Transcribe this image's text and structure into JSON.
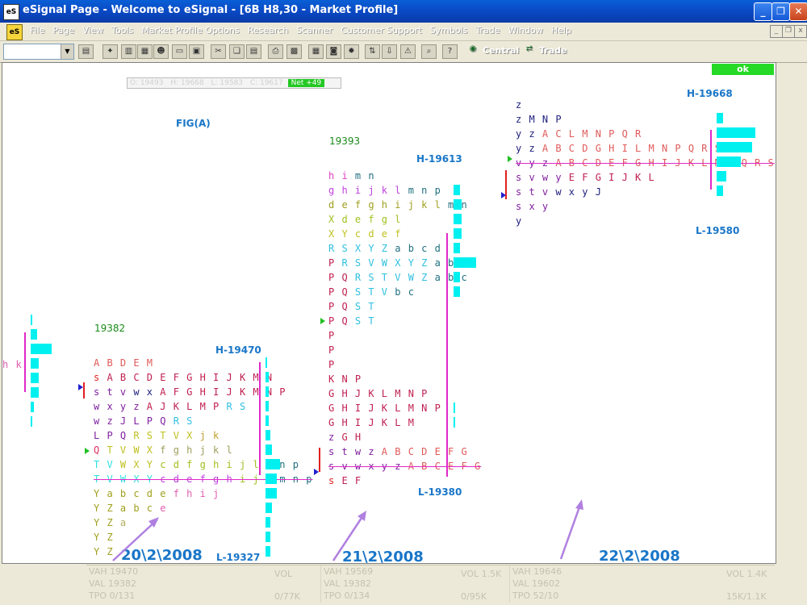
{
  "window": {
    "icon": "eS",
    "title": "eSignal Page - Welcome to eSignal - [6B H8,30 - Market Profile]",
    "controls": [
      "minimize-icon",
      "restore-icon",
      "close-icon"
    ]
  },
  "menu": {
    "items": [
      "File",
      "Page",
      "View",
      "Tools",
      "Market Profile Options",
      "Research",
      "Scanner",
      "Customer Support",
      "Symbols",
      "Trade",
      "Window",
      "Help"
    ]
  },
  "toolbar": {
    "symbol_value": "",
    "central_label": "Central",
    "trade_label": "Trade"
  },
  "status": {
    "ok": "ok"
  },
  "quote": {
    "o": "O: 19493",
    "h": "H: 19668",
    "l": "L: 19583",
    "c": "C: 19617",
    "net": "Net +49"
  },
  "chart": {
    "fig_label": "FIG(A)",
    "day1": {
      "open": "19382",
      "high": "H-19470",
      "low": "L-19327",
      "date": "20\\2\\2008"
    },
    "day2": {
      "open": "19393",
      "high": "H-19613",
      "low": "L-19380",
      "date": "21\\2\\2008"
    },
    "day3": {
      "high": "H-19668",
      "low": "L-19580",
      "date": "22\\2\\2008"
    },
    "left_fragment": "h k"
  },
  "profiles": {
    "day1": [
      [
        [
          "A B D E M",
          "#e05a5a"
        ]
      ],
      [
        [
          "s ",
          "#e02020"
        ],
        [
          "A B C D E F G H I J K M N",
          "#c02050"
        ]
      ],
      [
        [
          "s t v ",
          "#8020a0"
        ],
        [
          "w x ",
          "#202080"
        ],
        [
          "A F G H I J K M N P",
          "#c02050"
        ]
      ],
      [
        [
          "w x y z ",
          "#8020a0"
        ],
        [
          "A J K L M P ",
          "#c02050"
        ],
        [
          "R S",
          "#30c0e0"
        ]
      ],
      [
        [
          "w z J L P Q ",
          "#8020a0"
        ],
        [
          "R S",
          "#30c0e0"
        ]
      ],
      [
        [
          "L P Q ",
          "#8020a0"
        ],
        [
          "R S T V X ",
          "#c0c020"
        ],
        [
          "j k",
          "#c0a030"
        ]
      ],
      [
        [
          "Q ",
          "#e03060"
        ],
        [
          "T V W X ",
          "#c0c020"
        ],
        [
          "f g h j k l",
          "#a0a060"
        ]
      ],
      [
        [
          "T V ",
          "#30e0e0"
        ],
        [
          "W X Y ",
          "#c0c020"
        ],
        [
          "c d f g h i j l ",
          "#a0c020"
        ],
        [
          "m n p",
          "#207080"
        ]
      ],
      [
        [
          "T V W X Y ",
          "#30e0e0"
        ],
        [
          "c d e f g h ",
          "#c040e0"
        ],
        [
          "i j l ",
          "#a0c020"
        ],
        [
          "m n p",
          "#207080"
        ]
      ],
      [
        [
          "Y ",
          "#a0a020"
        ],
        [
          "a b c d e ",
          "#a0a020"
        ],
        [
          "f h i j",
          "#e060b0"
        ]
      ],
      [
        [
          "Y Z ",
          "#a0a020"
        ],
        [
          "a b c ",
          "#a0a020"
        ],
        [
          "e",
          "#e060b0"
        ]
      ],
      [
        [
          "Y Z ",
          "#a0a020"
        ],
        [
          "a",
          "#b0b060"
        ]
      ],
      [
        [
          "Y Z",
          "#a0a020"
        ]
      ],
      [
        [
          "Y Z",
          "#a0a020"
        ]
      ]
    ],
    "day2": [
      [
        [
          "h i ",
          "#e040c0"
        ],
        [
          "m n",
          "#207080"
        ]
      ],
      [
        [
          "g h i j k l ",
          "#c040e0"
        ],
        [
          "m n p",
          "#207080"
        ]
      ],
      [
        [
          "d e f g h i j k l ",
          "#a0a020"
        ],
        [
          "m n",
          "#207080"
        ]
      ],
      [
        [
          "X d e f g l",
          "#a0c020"
        ]
      ],
      [
        [
          "X Y c d e f",
          "#c0c020"
        ]
      ],
      [
        [
          "R S X Y Z ",
          "#30c0e0"
        ],
        [
          "a b c d",
          "#207080"
        ]
      ],
      [
        [
          "P ",
          "#c02050"
        ],
        [
          "R S V W X Y Z ",
          "#30c0e0"
        ],
        [
          "a b c",
          "#207080"
        ]
      ],
      [
        [
          "P Q ",
          "#c02050"
        ],
        [
          "R S T V W Z ",
          "#30c0e0"
        ],
        [
          "a b c",
          "#207080"
        ]
      ],
      [
        [
          "P Q ",
          "#c02050"
        ],
        [
          "S T V ",
          "#30c0e0"
        ],
        [
          "b c",
          "#207080"
        ]
      ],
      [
        [
          "P Q ",
          "#c02050"
        ],
        [
          "S T",
          "#30c0e0"
        ]
      ],
      [
        [
          "P Q ",
          "#c02050"
        ],
        [
          "S T",
          "#30c0e0"
        ]
      ],
      [
        [
          "P",
          "#c02050"
        ]
      ],
      [
        [
          "P",
          "#c02050"
        ]
      ],
      [
        [
          "P",
          "#c02050"
        ]
      ],
      [
        [
          "K N P",
          "#c02050"
        ]
      ],
      [
        [
          "G H J K L M N P",
          "#c02050"
        ]
      ],
      [
        [
          "G H I J K L M N P",
          "#c02050"
        ]
      ],
      [
        [
          "G H I J K L M",
          "#c02050"
        ]
      ],
      [
        [
          "z ",
          "#8020a0"
        ],
        [
          "G H",
          "#c02050"
        ]
      ],
      [
        [
          "s t w z ",
          "#8020a0"
        ],
        [
          "A B C D E F G",
          "#e05a5a"
        ]
      ],
      [
        [
          "s v w x y z ",
          "#8020a0"
        ],
        [
          "A B C E F G",
          "#e05a5a"
        ]
      ],
      [
        [
          "s ",
          "#e02020"
        ],
        [
          "E F",
          "#c02050"
        ]
      ]
    ],
    "day3": [
      [
        [
          "z",
          "#202080"
        ]
      ],
      [
        [
          "z M N P",
          "#202080"
        ]
      ],
      [
        [
          "y z ",
          "#202080"
        ],
        [
          "A C L M N P Q R",
          "#e05a5a"
        ]
      ],
      [
        [
          "y z ",
          "#202080"
        ],
        [
          "A B C D G H I L M N P Q R S",
          "#e05a5a"
        ]
      ],
      [
        [
          "v y z ",
          "#8020a0"
        ],
        [
          "A B C D E F G H I J K L M P Q R S",
          "#e05a5a"
        ]
      ],
      [
        [
          "s v w y ",
          "#8020a0"
        ],
        [
          "E F G I J K L",
          "#c02050"
        ]
      ],
      [
        [
          "s t v ",
          "#8020a0"
        ],
        [
          "w x y J",
          "#202080"
        ]
      ],
      [
        [
          "s x y",
          "#8020a0"
        ]
      ],
      [
        [
          "y",
          "#202080"
        ]
      ]
    ]
  },
  "info": {
    "day1": {
      "vah": "VAH 19470",
      "val": "VAL 19382",
      "tpo": "TPO 0/131",
      "vol": "VOL",
      "vol2": "0/77K"
    },
    "day2": {
      "vah": "VAH 19569",
      "val": "VAL 19382",
      "tpo": "TPO 0/134",
      "vol": "VOL 1.5K",
      "vol2": "0/95K"
    },
    "day3": {
      "vah": "VAH 19646",
      "val": "VAL 19602",
      "tpo": "TPO 52/10",
      "vol": "VOL 1.4K",
      "vol2": "15K/1.1K"
    }
  },
  "colors": {
    "histogram": "#00f0f0",
    "value_area_line": "#e028c8",
    "accent": "#1976c8",
    "ok_green": "#26d926"
  }
}
